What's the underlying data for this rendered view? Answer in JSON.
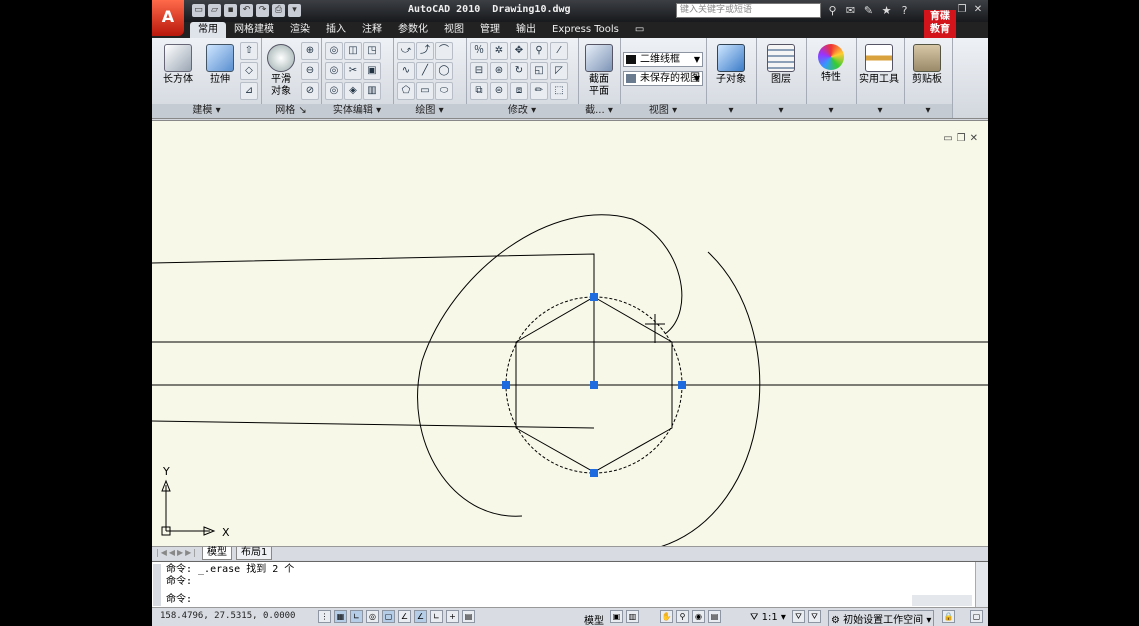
{
  "title_bar": {
    "app_button": "A",
    "title": "AutoCAD 2010  Drawing10.dwg",
    "search_placeholder": "键入关键字或短语",
    "brand_line1": "育碟",
    "brand_line2": "教育"
  },
  "tabs": [
    {
      "label": "常用",
      "active": true
    },
    {
      "label": "网格建模"
    },
    {
      "label": "渲染"
    },
    {
      "label": "插入"
    },
    {
      "label": "注释"
    },
    {
      "label": "参数化"
    },
    {
      "label": "视图"
    },
    {
      "label": "管理"
    },
    {
      "label": "输出"
    },
    {
      "label": "Express Tools"
    }
  ],
  "ribbon": {
    "panels": [
      {
        "label": "建模"
      },
      {
        "label": "网格"
      },
      {
        "label": "实体编辑"
      },
      {
        "label": "绘图"
      },
      {
        "label": "修改"
      },
      {
        "label": "截..."
      },
      {
        "label": "视图"
      }
    ],
    "box_btn": "长方体",
    "extrude_btn": "拉伸",
    "smooth_btn_line1": "平滑",
    "smooth_btn_line2": "对象",
    "section_btn_line1": "截面",
    "section_btn_line2": "平面",
    "visual_style": "二维线框",
    "named_view": "未保存的视图",
    "subobject": "子对象",
    "layers": "图层",
    "properties": "特性",
    "utilities": "实用工具",
    "clipboard": "剪贴板"
  },
  "drawing": {
    "ucs_x": "X",
    "ucs_y": "Y"
  },
  "layout_tabs": {
    "model": "模型",
    "layout1": "布局1"
  },
  "command": {
    "line1": "命令: _.erase 找到 2 个",
    "line2": "命令:",
    "prompt": "命令:"
  },
  "status": {
    "coords": "158.4796, 27.5315, 0.0000",
    "model_label": "模型",
    "scale": "1:1",
    "workspace": "初始设置工作空间"
  }
}
